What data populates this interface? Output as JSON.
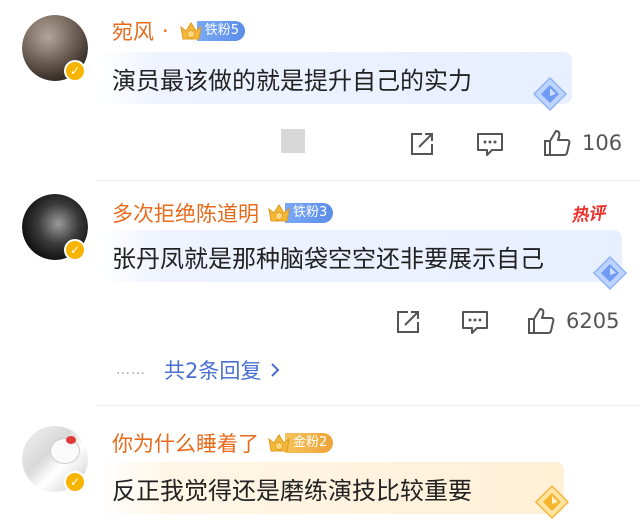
{
  "colors": {
    "username": "#e86b1c",
    "reply_link": "#4a6fd3",
    "hot": "#e8322b",
    "iron_badge": "#6b97ee",
    "gold_badge": "#f0ad3e"
  },
  "comments": [
    {
      "username": "宛风",
      "separator": "·",
      "fan_badge": "铁粉5",
      "text": "演员最该做的就是提升自己的实力",
      "like_count": "106",
      "icons": [
        "share-icon",
        "comment-icon",
        "like-icon"
      ]
    },
    {
      "username": "多次拒绝陈道明",
      "fan_badge": "铁粉3",
      "hot_tag": "热评",
      "text": "张丹凤就是那种脑袋空空还非要展示自己",
      "like_count": "6205",
      "replies_dots": "……",
      "replies_label": "共2条回复",
      "icons": [
        "share-icon",
        "comment-icon",
        "like-icon"
      ]
    },
    {
      "username": "你为什么睡着了",
      "fan_badge": "金粉2",
      "text": "反正我觉得还是磨练演技比较重要"
    }
  ]
}
